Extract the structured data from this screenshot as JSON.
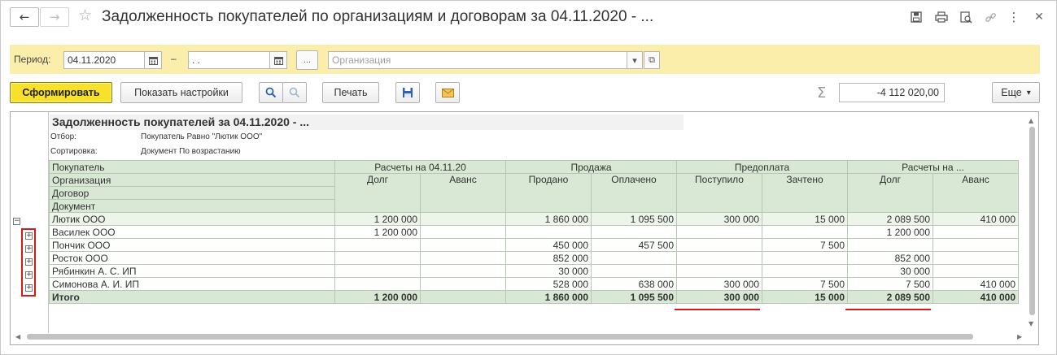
{
  "window": {
    "title": "Задолженность покупателей по организациям и договорам за 04.11.2020 - ..."
  },
  "icons": {
    "back": "←",
    "forward": "→",
    "favorite": "☆",
    "save": "floppy-icon",
    "print": "printer-icon",
    "preview": "preview-icon",
    "link": "link-icon",
    "more": "⋮",
    "close": "✕"
  },
  "filter": {
    "period_label": "Период:",
    "date_from": "04.11.2020",
    "dash": "–",
    "date_to": " .  .",
    "ellipsis": "...",
    "org_placeholder": "Организация",
    "dropdown_arrow": "▾",
    "open_icon": "⧉"
  },
  "toolbar": {
    "generate": "Сформировать",
    "show_settings": "Показать настройки",
    "print": "Печать",
    "more": "Еще",
    "more_arrow": "▾",
    "sigma": "Σ",
    "sum_value": "-4 112 020,00"
  },
  "report": {
    "title": "Задолженность покупателей за 04.11.2020 - ...",
    "filter_label": "Отбор:",
    "filter_value": "Покупатель Равно \"Лютик ООО\"",
    "sort_label": "Сортировка:",
    "sort_value": "Документ По возрастанию",
    "header": {
      "col_buyer": "Покупатель",
      "col_org": "Организация",
      "col_contract": "Договор",
      "col_document": "Документ",
      "group_settlements_start": "Расчеты на 04.11.20",
      "group_sale": "Продажа",
      "group_prepayment": "Предоплата",
      "group_settlements_end": "Расчеты на ...",
      "debt": "Долг",
      "advance": "Аванс",
      "sold": "Продано",
      "paid": "Оплачено",
      "received": "Поступило",
      "offset": "Зачтено",
      "debt2": "Долг",
      "advance2": "Аванс"
    },
    "group_row": {
      "name": "Лютик ООО",
      "cells": [
        "1 200 000",
        "",
        "1 860 000",
        "1 095 500",
        "300 000",
        "15 000",
        "2 089 500",
        "410 000"
      ]
    },
    "rows": [
      {
        "name": "Василек ООО",
        "cells": [
          "1 200 000",
          "",
          "",
          "",
          "",
          "",
          "1 200 000",
          ""
        ]
      },
      {
        "name": "Пончик ООО",
        "cells": [
          "",
          "",
          "450 000",
          "457 500",
          "",
          "7 500",
          "",
          ""
        ]
      },
      {
        "name": "Росток ООО",
        "cells": [
          "",
          "",
          "852 000",
          "",
          "",
          "",
          "852 000",
          ""
        ]
      },
      {
        "name": "Рябинкин А. С. ИП",
        "cells": [
          "",
          "",
          "30 000",
          "",
          "",
          "",
          "30 000",
          ""
        ]
      },
      {
        "name": "Симонова А. И. ИП",
        "cells": [
          "",
          "",
          "528 000",
          "638 000",
          "300 000",
          "7 500",
          "7 500",
          "410 000"
        ]
      }
    ],
    "total_row": {
      "name": "Итого",
      "cells": [
        "1 200 000",
        "",
        "1 860 000",
        "1 095 500",
        "300 000",
        "15 000",
        "2 089 500",
        "410 000"
      ]
    },
    "expand_symbol": "+",
    "collapse_symbol": "−"
  }
}
